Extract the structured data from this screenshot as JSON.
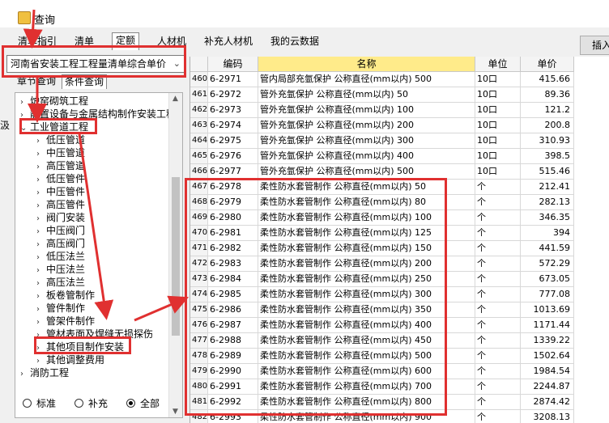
{
  "window": {
    "title": "查询"
  },
  "tabs": [
    {
      "label": "清单指引",
      "active": false
    },
    {
      "label": "清单",
      "active": false
    },
    {
      "label": "定额",
      "active": true
    },
    {
      "label": "人材机",
      "active": false
    },
    {
      "label": "补充人材机",
      "active": false
    },
    {
      "label": "我的云数据",
      "active": false
    }
  ],
  "insert_button": {
    "label": "插入"
  },
  "library_select": {
    "value": "河南省安装工程工程量清单综合单价"
  },
  "left_tabs": [
    {
      "label": "章节查询",
      "active": false
    },
    {
      "label": "条件查询",
      "active": true
    }
  ],
  "side_cut_label": "汲",
  "tree": [
    {
      "label": "炉窑砌筑工程",
      "level": 1,
      "expanded": false
    },
    {
      "label": "静置设备与金属结构制作安装工程",
      "level": 1,
      "expanded": false
    },
    {
      "label": "工业管道工程",
      "level": 1,
      "expanded": true
    },
    {
      "label": "低压管道",
      "level": 2,
      "expanded": false
    },
    {
      "label": "中压管道",
      "level": 2,
      "expanded": false
    },
    {
      "label": "高压管道",
      "level": 2,
      "expanded": false
    },
    {
      "label": "低压管件",
      "level": 2,
      "expanded": false
    },
    {
      "label": "中压管件",
      "level": 2,
      "expanded": false
    },
    {
      "label": "高压管件",
      "level": 2,
      "expanded": false
    },
    {
      "label": "阀门安装",
      "level": 2,
      "expanded": false
    },
    {
      "label": "中压阀门",
      "level": 2,
      "expanded": false
    },
    {
      "label": "高压阀门",
      "level": 2,
      "expanded": false
    },
    {
      "label": "低压法兰",
      "level": 2,
      "expanded": false
    },
    {
      "label": "中压法兰",
      "level": 2,
      "expanded": false
    },
    {
      "label": "高压法兰",
      "level": 2,
      "expanded": false
    },
    {
      "label": "板卷管制作",
      "level": 2,
      "expanded": false
    },
    {
      "label": "管件制作",
      "level": 2,
      "expanded": false
    },
    {
      "label": "管架件制作",
      "level": 2,
      "expanded": false
    },
    {
      "label": "管材表面及焊缝无损探伤",
      "level": 2,
      "expanded": false
    },
    {
      "label": "其他项目制作安装",
      "level": 2,
      "expanded": false
    },
    {
      "label": "其他调整费用",
      "level": 2,
      "expanded": false
    },
    {
      "label": "消防工程",
      "level": 1,
      "expanded": false
    }
  ],
  "filter_radios": [
    {
      "label": "标准",
      "selected": false
    },
    {
      "label": "补充",
      "selected": false
    },
    {
      "label": "全部",
      "selected": true
    }
  ],
  "grid": {
    "columns": [
      "编码",
      "名称",
      "单位",
      "单价"
    ],
    "rows": [
      {
        "n": "460",
        "code": "6-2971",
        "name": "管内局部充氩保护 公称直径(mm以内) 500",
        "unit": "10口",
        "price": "415.66"
      },
      {
        "n": "461",
        "code": "6-2972",
        "name": "管外充氩保护 公称直径(mm以内) 50",
        "unit": "10口",
        "price": "89.36"
      },
      {
        "n": "462",
        "code": "6-2973",
        "name": "管外充氩保护 公称直径(mm以内) 100",
        "unit": "10口",
        "price": "121.2"
      },
      {
        "n": "463",
        "code": "6-2974",
        "name": "管外充氩保护 公称直径(mm以内) 200",
        "unit": "10口",
        "price": "200.8"
      },
      {
        "n": "464",
        "code": "6-2975",
        "name": "管外充氩保护 公称直径(mm以内) 300",
        "unit": "10口",
        "price": "310.93"
      },
      {
        "n": "465",
        "code": "6-2976",
        "name": "管外充氩保护 公称直径(mm以内) 400",
        "unit": "10口",
        "price": "398.5"
      },
      {
        "n": "466",
        "code": "6-2977",
        "name": "管外充氩保护 公称直径(mm以内) 500",
        "unit": "10口",
        "price": "515.46"
      },
      {
        "n": "467",
        "code": "6-2978",
        "name": "柔性防水套管制作 公称直径(mm以内) 50",
        "unit": "个",
        "price": "212.41"
      },
      {
        "n": "468",
        "code": "6-2979",
        "name": "柔性防水套管制作 公称直径(mm以内) 80",
        "unit": "个",
        "price": "282.13"
      },
      {
        "n": "469",
        "code": "6-2980",
        "name": "柔性防水套管制作 公称直径(mm以内) 100",
        "unit": "个",
        "price": "346.35"
      },
      {
        "n": "470",
        "code": "6-2981",
        "name": "柔性防水套管制作 公称直径(mm以内) 125",
        "unit": "个",
        "price": "394"
      },
      {
        "n": "471",
        "code": "6-2982",
        "name": "柔性防水套管制作 公称直径(mm以内) 150",
        "unit": "个",
        "price": "441.59"
      },
      {
        "n": "472",
        "code": "6-2983",
        "name": "柔性防水套管制作 公称直径(mm以内) 200",
        "unit": "个",
        "price": "572.29"
      },
      {
        "n": "473",
        "code": "6-2984",
        "name": "柔性防水套管制作 公称直径(mm以内) 250",
        "unit": "个",
        "price": "673.05"
      },
      {
        "n": "474",
        "code": "6-2985",
        "name": "柔性防水套管制作 公称直径(mm以内) 300",
        "unit": "个",
        "price": "777.08"
      },
      {
        "n": "475",
        "code": "6-2986",
        "name": "柔性防水套管制作 公称直径(mm以内) 350",
        "unit": "个",
        "price": "1013.69"
      },
      {
        "n": "476",
        "code": "6-2987",
        "name": "柔性防水套管制作 公称直径(mm以内) 400",
        "unit": "个",
        "price": "1171.44"
      },
      {
        "n": "477",
        "code": "6-2988",
        "name": "柔性防水套管制作 公称直径(mm以内) 450",
        "unit": "个",
        "price": "1339.22"
      },
      {
        "n": "478",
        "code": "6-2989",
        "name": "柔性防水套管制作 公称直径(mm以内) 500",
        "unit": "个",
        "price": "1502.64"
      },
      {
        "n": "479",
        "code": "6-2990",
        "name": "柔性防水套管制作 公称直径(mm以内) 600",
        "unit": "个",
        "price": "1984.54"
      },
      {
        "n": "480",
        "code": "6-2991",
        "name": "柔性防水套管制作 公称直径(mm以内) 700",
        "unit": "个",
        "price": "2244.87"
      },
      {
        "n": "481",
        "code": "6-2992",
        "name": "柔性防水套管制作 公称直径(mm以内) 800",
        "unit": "个",
        "price": "2874.42"
      },
      {
        "n": "482",
        "code": "6-2993",
        "name": "柔性防水套管制作 公称直径(mm以内) 900",
        "unit": "个",
        "price": "3208.13"
      }
    ]
  },
  "annotation_color": "#e03030"
}
